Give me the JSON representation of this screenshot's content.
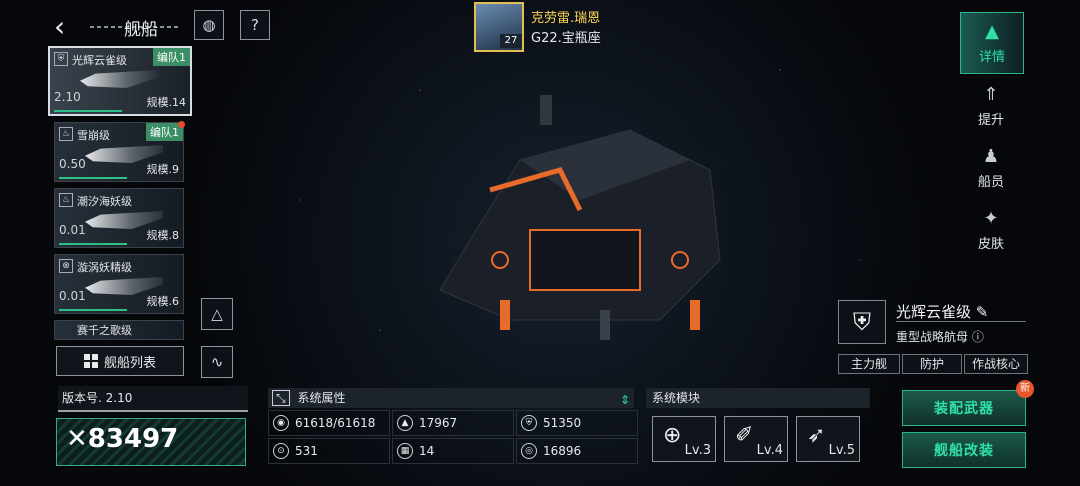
{
  "header": {
    "title": "舰船"
  },
  "player": {
    "name": "克劳雷.瑞恩",
    "level": "27",
    "sector": "G22.宝瓶座"
  },
  "ships": [
    {
      "name": "光辉云雀级",
      "version": "2.10",
      "scale": "规模.14",
      "fleet": "编队1",
      "selected": true
    },
    {
      "name": "雪崩级",
      "version": "0.50",
      "scale": "规模.9",
      "fleet": "编队1",
      "new": true
    },
    {
      "name": "潮汐海妖级",
      "version": "0.01",
      "scale": "规模.8"
    },
    {
      "name": "漩涡妖精级",
      "version": "0.01",
      "scale": "规模.6"
    },
    {
      "name": "赛千之歌级"
    }
  ],
  "ship_list_label": "舰船列表",
  "version_label": "版本号. 2.10",
  "power": "83497",
  "tabs": [
    {
      "label": "详情",
      "icon": "detail-icon",
      "active": true
    },
    {
      "label": "提升",
      "icon": "upgrade-icon"
    },
    {
      "label": "船员",
      "icon": "crew-icon"
    },
    {
      "label": "皮肤",
      "icon": "skin-icon"
    }
  ],
  "ship_info": {
    "name": "光辉云雀级",
    "type": "重型战略航母",
    "roles": [
      "主力舰",
      "防护",
      "作战核心"
    ]
  },
  "attributes": {
    "title": "系统属性",
    "items": [
      "61618/61618",
      "17967",
      "51350",
      "531",
      "14",
      "16896"
    ]
  },
  "modules": {
    "title": "系统模块",
    "items": [
      {
        "level": "Lv.3",
        "icon": "radar-icon"
      },
      {
        "level": "Lv.4",
        "icon": "cannon-icon"
      },
      {
        "level": "Lv.5",
        "icon": "missile-icon"
      }
    ]
  },
  "actions": {
    "equip": "装配武器",
    "modify": "舰船改装",
    "new_badge": "新"
  },
  "colors": {
    "accent": "#2ee1a5",
    "fleet_tag": "#3a8f67",
    "gold": "#ffd65a",
    "alert": "#e8552a"
  }
}
